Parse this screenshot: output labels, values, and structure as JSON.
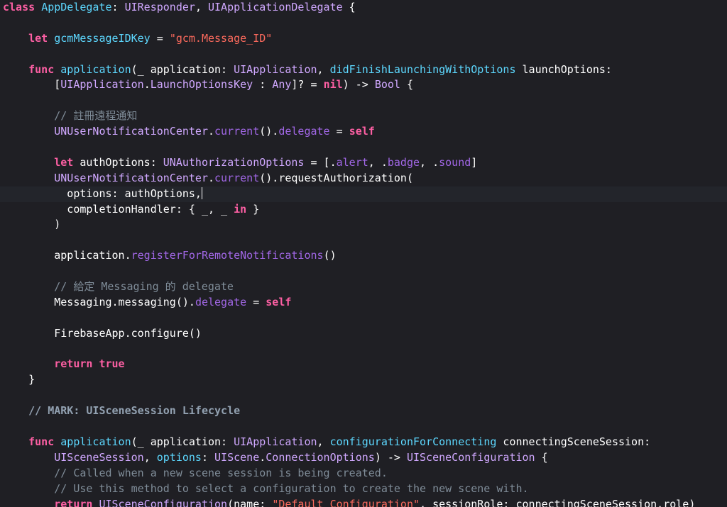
{
  "editor": {
    "colors": {
      "background": "#1f1f24",
      "keyword": "#fc5fa3",
      "type": "#d0a8ff",
      "property": "#a167e6",
      "string": "#fc6a5d",
      "comment": "#7f8c98",
      "plain": "#ffffff"
    },
    "current_line": 12,
    "lines": [
      [
        {
          "t": "class",
          "k": "kw"
        },
        {
          "t": " "
        },
        {
          "t": "AppDelegate",
          "k": "dec"
        },
        {
          "t": ": "
        },
        {
          "t": "UIResponder",
          "k": "type"
        },
        {
          "t": ", "
        },
        {
          "t": "UIApplicationDelegate",
          "k": "type"
        },
        {
          "t": " {"
        }
      ],
      [],
      [
        {
          "t": "    "
        },
        {
          "t": "let",
          "k": "kw"
        },
        {
          "t": " "
        },
        {
          "t": "gcmMessageIDKey",
          "k": "dec"
        },
        {
          "t": " = "
        },
        {
          "t": "\"gcm.Message_ID\"",
          "k": "str"
        }
      ],
      [],
      [
        {
          "t": "    "
        },
        {
          "t": "func",
          "k": "kw"
        },
        {
          "t": " "
        },
        {
          "t": "application",
          "k": "dec"
        },
        {
          "t": "(_ application: "
        },
        {
          "t": "UIApplication",
          "k": "type"
        },
        {
          "t": ", "
        },
        {
          "t": "didFinishLaunchingWithOptions",
          "k": "dec"
        },
        {
          "t": " launchOptions:"
        }
      ],
      [
        {
          "t": "        ["
        },
        {
          "t": "UIApplication",
          "k": "type"
        },
        {
          "t": "."
        },
        {
          "t": "LaunchOptionsKey",
          "k": "type"
        },
        {
          "t": " : "
        },
        {
          "t": "Any",
          "k": "type"
        },
        {
          "t": "]? = "
        },
        {
          "t": "nil",
          "k": "kw"
        },
        {
          "t": ") -> "
        },
        {
          "t": "Bool",
          "k": "type"
        },
        {
          "t": " {"
        }
      ],
      [],
      [
        {
          "t": "        "
        },
        {
          "t": "// 註冊遠程通知",
          "k": "cmt"
        }
      ],
      [
        {
          "t": "        "
        },
        {
          "t": "UNUserNotificationCenter",
          "k": "type"
        },
        {
          "t": "."
        },
        {
          "t": "current",
          "k": "prop"
        },
        {
          "t": "()."
        },
        {
          "t": "delegate",
          "k": "prop"
        },
        {
          "t": " = "
        },
        {
          "t": "self",
          "k": "kw"
        }
      ],
      [],
      [
        {
          "t": "        "
        },
        {
          "t": "let",
          "k": "kw"
        },
        {
          "t": " authOptions: "
        },
        {
          "t": "UNAuthorizationOptions",
          "k": "type"
        },
        {
          "t": " = [."
        },
        {
          "t": "alert",
          "k": "prop"
        },
        {
          "t": ", ."
        },
        {
          "t": "badge",
          "k": "prop"
        },
        {
          "t": ", ."
        },
        {
          "t": "sound",
          "k": "prop"
        },
        {
          "t": "]"
        }
      ],
      [
        {
          "t": "        "
        },
        {
          "t": "UNUserNotificationCenter",
          "k": "type"
        },
        {
          "t": "."
        },
        {
          "t": "current",
          "k": "prop"
        },
        {
          "t": "().requestAuthorization("
        }
      ],
      [
        {
          "t": "          options: authOptions,"
        }
      ],
      [
        {
          "t": "          completionHandler: { _, _ "
        },
        {
          "t": "in",
          "k": "kw"
        },
        {
          "t": " }"
        }
      ],
      [
        {
          "t": "        )"
        }
      ],
      [],
      [
        {
          "t": "        application."
        },
        {
          "t": "registerForRemoteNotifications",
          "k": "prop"
        },
        {
          "t": "()"
        }
      ],
      [],
      [
        {
          "t": "        "
        },
        {
          "t": "// 給定 Messaging 的 delegate",
          "k": "cmt"
        }
      ],
      [
        {
          "t": "        Messaging.messaging()."
        },
        {
          "t": "delegate",
          "k": "prop"
        },
        {
          "t": " = "
        },
        {
          "t": "self",
          "k": "kw"
        }
      ],
      [],
      [
        {
          "t": "        FirebaseApp.configure()"
        }
      ],
      [],
      [
        {
          "t": "        "
        },
        {
          "t": "return",
          "k": "kw"
        },
        {
          "t": " "
        },
        {
          "t": "true",
          "k": "kw"
        }
      ],
      [
        {
          "t": "    }"
        }
      ],
      [],
      [
        {
          "t": "    "
        },
        {
          "t": "// MARK: UISceneSession Lifecycle",
          "k": "mark"
        }
      ],
      [],
      [
        {
          "t": "    "
        },
        {
          "t": "func",
          "k": "kw"
        },
        {
          "t": " "
        },
        {
          "t": "application",
          "k": "dec"
        },
        {
          "t": "(_ application: "
        },
        {
          "t": "UIApplication",
          "k": "type"
        },
        {
          "t": ", "
        },
        {
          "t": "configurationForConnecting",
          "k": "dec"
        },
        {
          "t": " connectingSceneSession:"
        }
      ],
      [
        {
          "t": "        "
        },
        {
          "t": "UISceneSession",
          "k": "type"
        },
        {
          "t": ", "
        },
        {
          "t": "options",
          "k": "dec"
        },
        {
          "t": ": "
        },
        {
          "t": "UIScene",
          "k": "type"
        },
        {
          "t": "."
        },
        {
          "t": "ConnectionOptions",
          "k": "type"
        },
        {
          "t": ") -> "
        },
        {
          "t": "UISceneConfiguration",
          "k": "type"
        },
        {
          "t": " {"
        }
      ],
      [
        {
          "t": "        "
        },
        {
          "t": "// Called when a new scene session is being created.",
          "k": "cmt"
        }
      ],
      [
        {
          "t": "        "
        },
        {
          "t": "// Use this method to select a configuration to create the new scene with.",
          "k": "cmt"
        }
      ],
      [
        {
          "t": "        "
        },
        {
          "t": "return",
          "k": "kw"
        },
        {
          "t": " "
        },
        {
          "t": "UISceneConfiguration",
          "k": "type"
        },
        {
          "t": "(name: "
        },
        {
          "t": "\"Default Configuration\"",
          "k": "str"
        },
        {
          "t": ", sessionRole: connectingSceneSession.role)"
        }
      ]
    ]
  }
}
